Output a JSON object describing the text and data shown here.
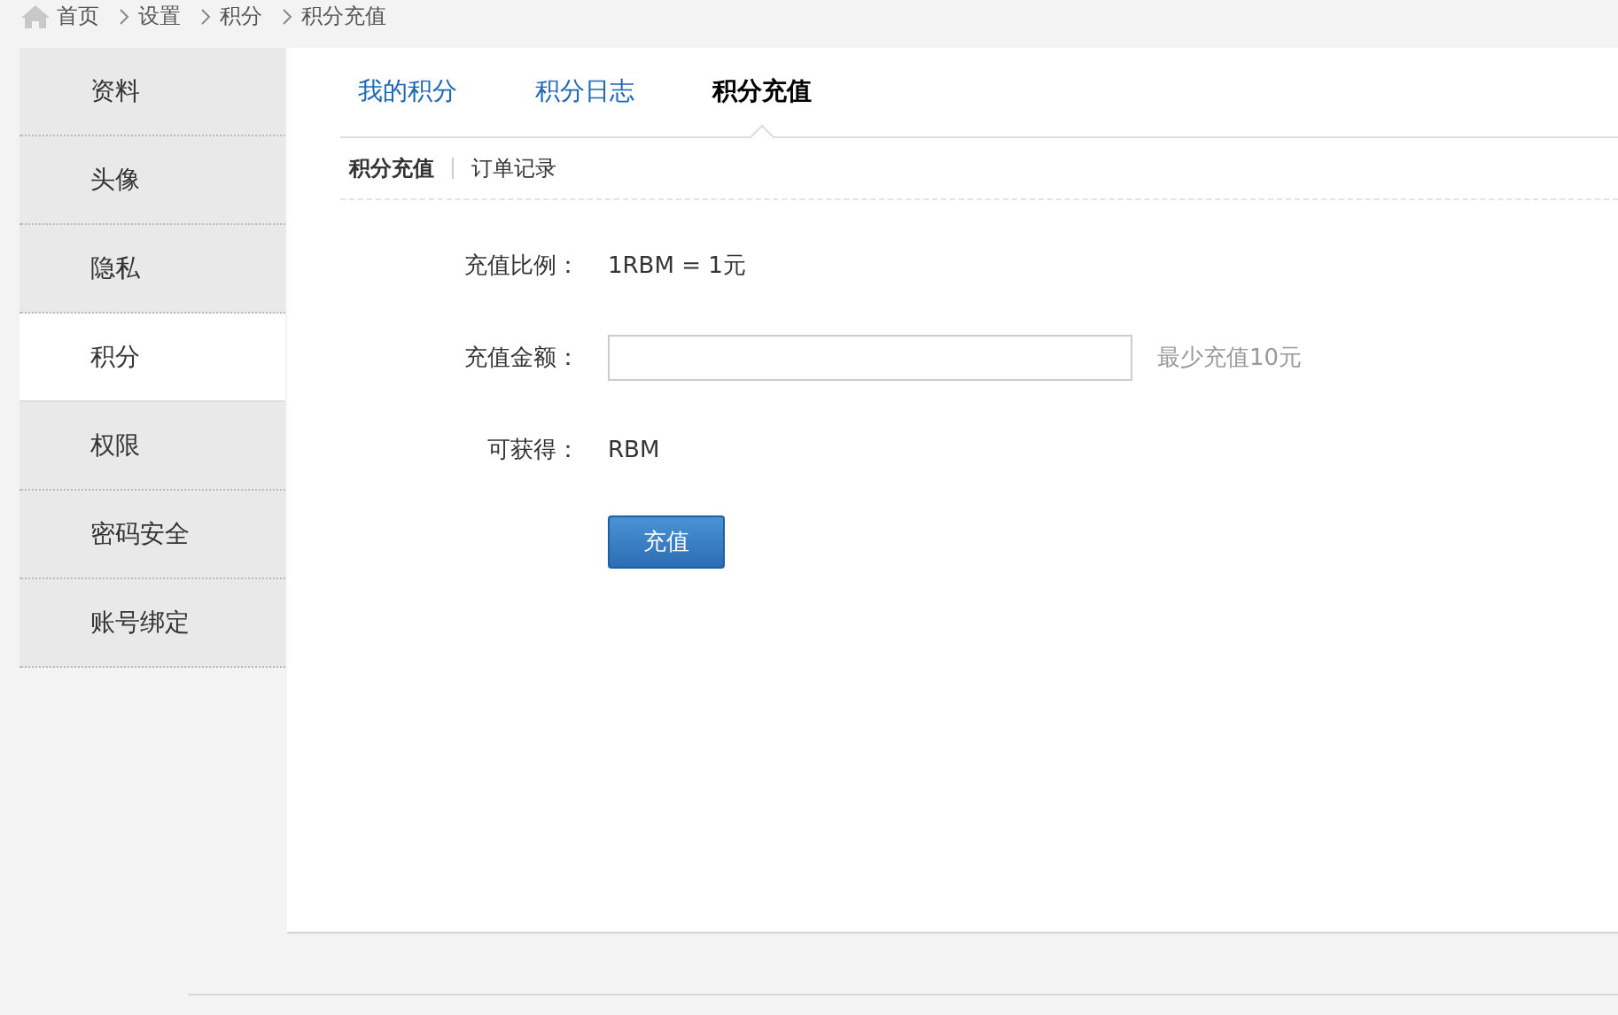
{
  "breadcrumb": [
    "首页",
    "设置",
    "积分",
    "积分充值"
  ],
  "sidebar": {
    "items": [
      {
        "label": "资料",
        "selected": false
      },
      {
        "label": "头像",
        "selected": false
      },
      {
        "label": "隐私",
        "selected": false
      },
      {
        "label": "积分",
        "selected": true
      },
      {
        "label": "权限",
        "selected": false
      },
      {
        "label": "密码安全",
        "selected": false
      },
      {
        "label": "账号绑定",
        "selected": false
      }
    ]
  },
  "tabs": [
    {
      "label": "我的积分",
      "selected": false
    },
    {
      "label": "积分日志",
      "selected": false
    },
    {
      "label": "积分充值",
      "selected": true
    }
  ],
  "subtabs": [
    {
      "label": "积分充值",
      "selected": true
    },
    {
      "label": "订单记录",
      "selected": false
    }
  ],
  "form": {
    "rows": [
      {
        "kind": "text",
        "label": "充值比例：",
        "value": "1RBM = 1元"
      },
      {
        "kind": "input",
        "label": "充值金额：",
        "hint": "最少充值10元"
      },
      {
        "kind": "text",
        "label": "可获得：",
        "value": "RBM"
      }
    ],
    "submit": "充值"
  }
}
